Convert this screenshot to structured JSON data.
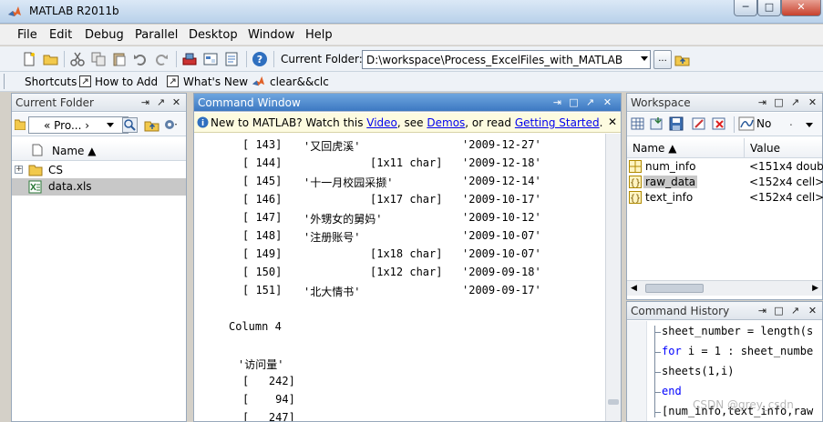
{
  "window": {
    "title": "MATLAB  R2011b",
    "minimize_glyph": "─",
    "maximize_glyph": "□",
    "close_glyph": "✕"
  },
  "menu": [
    "File",
    "Edit",
    "Debug",
    "Parallel",
    "Desktop",
    "Window",
    "Help"
  ],
  "toolbar": {
    "current_folder_label": "Current Folder:",
    "current_folder_path": "D:\\workspace\\Process_ExcelFiles_with_MATLAB",
    "browse_label": "..."
  },
  "shortcuts": {
    "shortcuts_label": "Shortcuts",
    "how_to_add": "How to Add",
    "whats_new": "What's New",
    "clear_clc": "clear&&clc"
  },
  "current_folder": {
    "title": "Current Folder",
    "breadcrumb": "«  Pro...  ›",
    "column_name": "Name ▲",
    "items": [
      {
        "name": "CS",
        "type": "folder"
      },
      {
        "name": "data.xls",
        "type": "file"
      }
    ]
  },
  "command_window": {
    "title": "Command Window",
    "notice": {
      "prefix": "New to MATLAB? Watch this ",
      "link1": "Video",
      "mid1": ", see ",
      "link2": "Demos",
      "mid2": ", or read ",
      "link3": "Getting Started",
      "suffix": "."
    },
    "rows": [
      {
        "idx": "[ 143]",
        "a": "'又回虎溪'",
        "b": "",
        "c": "'2009-12-27'"
      },
      {
        "idx": "[ 144]",
        "a": "",
        "b": "[1x11 char]",
        "c": "'2009-12-18'"
      },
      {
        "idx": "[ 145]",
        "a": "'十一月校园采撷'",
        "b": "",
        "c": "'2009-12-14'"
      },
      {
        "idx": "[ 146]",
        "a": "",
        "b": "[1x17 char]",
        "c": "'2009-10-17'"
      },
      {
        "idx": "[ 147]",
        "a": "'外甥女的舅妈'",
        "b": "",
        "c": "'2009-10-12'"
      },
      {
        "idx": "[ 148]",
        "a": "'注册账号'",
        "b": "",
        "c": "'2009-10-07'"
      },
      {
        "idx": "[ 149]",
        "a": "",
        "b": "[1x18 char]",
        "c": "'2009-10-07'"
      },
      {
        "idx": "[ 150]",
        "a": "",
        "b": "[1x12 char]",
        "c": "'2009-09-18'"
      },
      {
        "idx": "[ 151]",
        "a": "'北大情书'",
        "b": "",
        "c": "'2009-09-17'"
      }
    ],
    "column_header": "Column 4",
    "col4_title": "'访问量'",
    "col4_values": [
      "[   242]",
      "[    94]",
      "[   247]"
    ]
  },
  "workspace": {
    "title": "Workspace",
    "filter_label": "No",
    "col_name": "Name ▲",
    "col_value": "Value",
    "vars": [
      {
        "name": "num_info",
        "value": "<151x4 double>",
        "icon": "matrix-icon",
        "selected": false
      },
      {
        "name": "raw_data",
        "value": "<152x4 cell>",
        "icon": "cell-icon",
        "selected": true
      },
      {
        "name": "text_info",
        "value": "<152x4 cell>",
        "icon": "cell-icon",
        "selected": false
      }
    ]
  },
  "command_history": {
    "title": "Command History",
    "lines": [
      {
        "text": "sheet_number = length(s",
        "kind": "code"
      },
      {
        "text": "for i = 1 : sheet_numbe",
        "kind": "for"
      },
      {
        "text": "sheets(1,i)",
        "kind": "code"
      },
      {
        "text": "end",
        "kind": "end"
      },
      {
        "text": "[num_info,text_info,raw",
        "kind": "code"
      }
    ],
    "watermark": "CSDN @grey_csdn"
  },
  "colors": {
    "accent": "#3c78c2",
    "link": "#0000ee",
    "keyword": "#0000ff",
    "selection": "#c8c8c8"
  }
}
